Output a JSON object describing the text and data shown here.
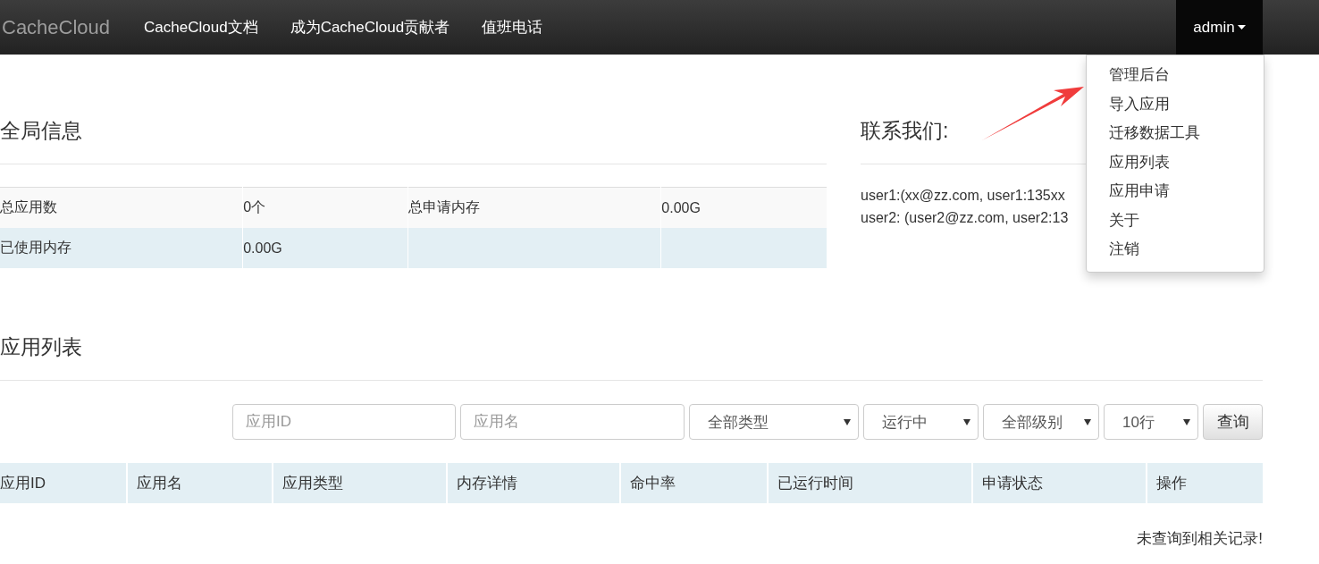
{
  "navbar": {
    "brand": "CacheCloud",
    "links": [
      "CacheCloud文档",
      "成为CacheCloud贡献者",
      "值班电话"
    ],
    "user_menu": {
      "label": "admin",
      "expanded": true,
      "items": [
        "管理后台",
        "导入应用",
        "迁移数据工具",
        "应用列表",
        "应用申请",
        "关于",
        "注销"
      ]
    }
  },
  "global_info": {
    "title": "全局信息",
    "rows": [
      [
        "总应用数",
        "0个",
        "总申请内存",
        "0.00G"
      ],
      [
        "已使用内存",
        "0.00G"
      ]
    ]
  },
  "contact": {
    "title": "联系我们:",
    "lines": [
      "user1:(xx@zz.com, user1:135xx",
      "user2: (user2@zz.com, user2:13"
    ]
  },
  "app_list": {
    "title": "应用列表",
    "filters": [
      {
        "kind": "input",
        "placeholder": "应用ID"
      },
      {
        "kind": "input",
        "placeholder": "应用名"
      },
      {
        "kind": "select",
        "value": "全部类型"
      },
      {
        "kind": "select",
        "value": "运行中"
      },
      {
        "kind": "select",
        "value": "全部级别"
      },
      {
        "kind": "select",
        "value": "10行"
      }
    ],
    "query_button": "查询",
    "table": {
      "columns": [
        "应用ID",
        "应用名",
        "应用类型",
        "内存详情",
        "命中率",
        "已运行时间",
        "申请状态",
        "操作"
      ],
      "empty_message": "未查询到相关记录!"
    }
  }
}
